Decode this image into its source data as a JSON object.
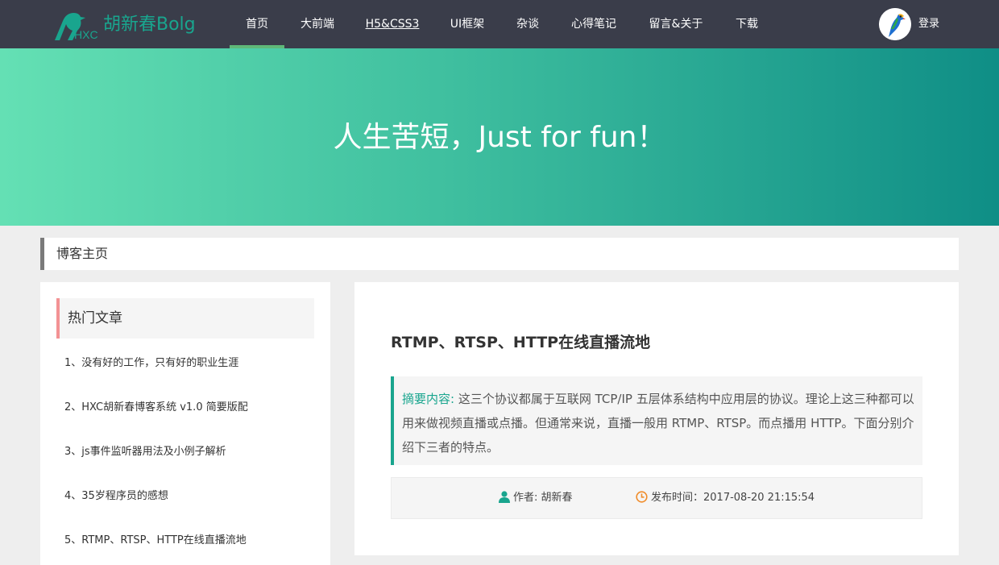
{
  "header": {
    "logo_text": "胡新春Bolg",
    "logo_small": "HXC",
    "nav": [
      {
        "label": "首页"
      },
      {
        "label": "大前端"
      },
      {
        "label": "H5&CSS3"
      },
      {
        "label": "UI框架"
      },
      {
        "label": "杂谈"
      },
      {
        "label": "心得笔记"
      },
      {
        "label": "留言&关于"
      },
      {
        "label": "下载"
      }
    ],
    "active_index": 0,
    "login_label": "登录"
  },
  "banner": {
    "slogan": "人生苦短，Just for fun！"
  },
  "breadcrumb": {
    "label": "博客主页"
  },
  "hot": {
    "title": "热门文章",
    "items": [
      "1、没有好的工作，只有好的职业生涯",
      "2、HXC胡新春博客系统 v1.0 简要版配",
      "3、js事件监听器用法及小例子解析",
      "4、35岁程序员的感想",
      "5、RTMP、RTSP、HTTP在线直播流地"
    ]
  },
  "article": {
    "title": "RTMP、RTSP、HTTP在线直播流地",
    "summary_label": "摘要内容:",
    "summary_text": "这三个协议都属于互联网 TCP/IP 五层体系结构中应用层的协议。理论上这三种都可以用来做视频直播或点播。但通常来说，直播一般用 RTMP、RTSP。而点播用 HTTP。下面分别介绍下三者的特点。",
    "author": "作者: 胡新春",
    "publish_time": "发布时间：2017-08-20 21:15:54"
  },
  "colors": {
    "topbar": "#3a3d4a",
    "accent": "#19a58e",
    "active_underline": "#5fb878",
    "hot_border": "#f39294",
    "clock_icon": "#f08c2a"
  }
}
